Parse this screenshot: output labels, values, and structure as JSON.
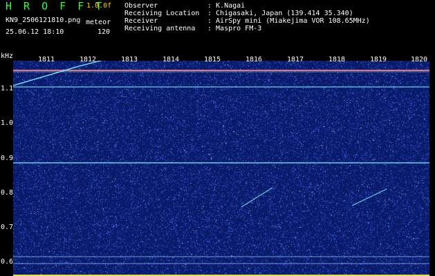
{
  "header": {
    "app_title": "H R O F F T",
    "version": "1.0.0f",
    "filename": "KN9_2506121810.png",
    "mode_label": "meteor",
    "datetime": "25.06.12 18:10",
    "value": "120",
    "meta": [
      {
        "label": "Observer",
        "value": ": K.Nagai"
      },
      {
        "label": "Receiving Location",
        "value": ": Chigasaki, Japan (139.414 35.340)"
      },
      {
        "label": "Receiver",
        "value": ": AirSpy mini (Miakejima VOR 108.65MHz)"
      },
      {
        "label": "Receiving antenna",
        "value": ": Maspro FM-3"
      }
    ]
  },
  "plot": {
    "y_unit": "kHz",
    "y_ticks": [
      "1.1",
      "1.0",
      "0.9",
      "0.8",
      "0.7",
      "0.6"
    ],
    "x_ticks": [
      "1811",
      "1812",
      "1813",
      "1814",
      "1815",
      "1816",
      "1817",
      "1818",
      "1819",
      "1820"
    ],
    "colors": {
      "background": "#0a1a6a",
      "noise": "#4a7dff",
      "line": "#78f0ff",
      "accent": "#ff6a6a",
      "baseline": "#ffff00"
    }
  }
}
